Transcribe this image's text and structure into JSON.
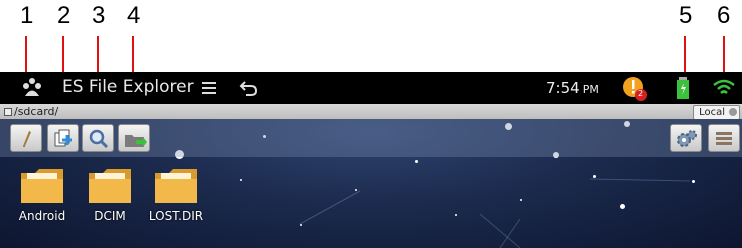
{
  "callouts": [
    "1",
    "2",
    "3",
    "4",
    "5",
    "6"
  ],
  "titlebar": {
    "app_title": "ES File Explorer",
    "time": "7:54",
    "ampm": "PM",
    "notification_count": "2"
  },
  "pathbar": {
    "path": "/sdcard/",
    "location": "Local"
  },
  "folders": [
    {
      "label": "Android"
    },
    {
      "label": "DCIM"
    },
    {
      "label": "LOST.DIR"
    }
  ],
  "colors": {
    "arrow": "#e01010",
    "folder": "#f2b94a",
    "accent_green": "#3cc13c"
  },
  "icons": {
    "edit": "pencil-icon",
    "new": "new-file-icon",
    "search": "search-icon",
    "transfer": "folder-transfer-icon",
    "settings": "gear-icon",
    "view": "list-view-icon"
  }
}
